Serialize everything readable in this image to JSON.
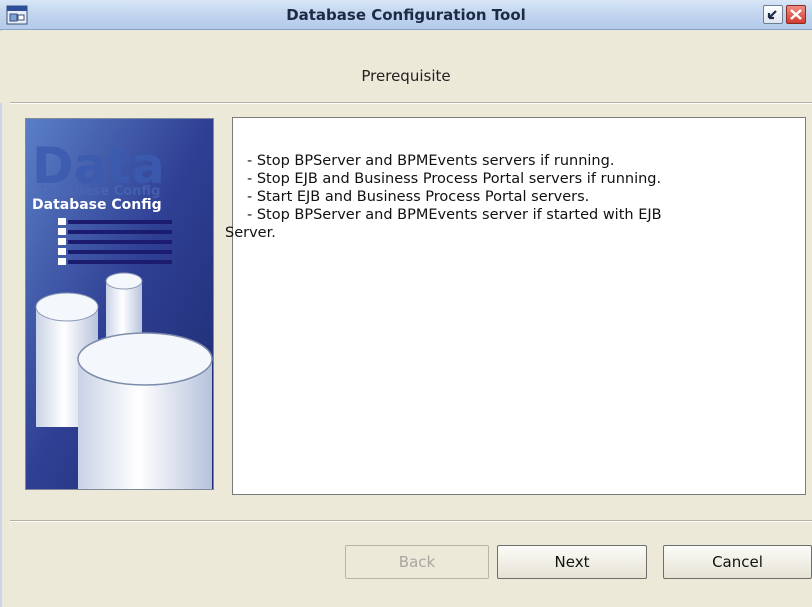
{
  "window": {
    "title": "Database Configuration Tool",
    "app_icon": "app-window-icon",
    "controls": [
      "restore-icon",
      "close-icon"
    ]
  },
  "page": {
    "subtitle": "Prerequisite"
  },
  "side_image": {
    "big_word": "Data",
    "caption": "Database Config",
    "ghost_caption": "Database Config"
  },
  "prerequisites": {
    "lines": [
      " - Stop BPServer and BPMEvents servers if running.",
      " - Stop EJB and Business Process Portal servers if running.",
      " - Start EJB and Business Process Portal servers.",
      " - Stop BPServer and BPMEvents server if started with EJB",
      "Server."
    ]
  },
  "buttons": {
    "back": "Back",
    "next": "Next",
    "cancel": "Cancel"
  },
  "colors": {
    "titlebar": "#c3d6ef",
    "dialog_bg": "#ECE9D8",
    "image_bg": "#2a3d8a"
  }
}
